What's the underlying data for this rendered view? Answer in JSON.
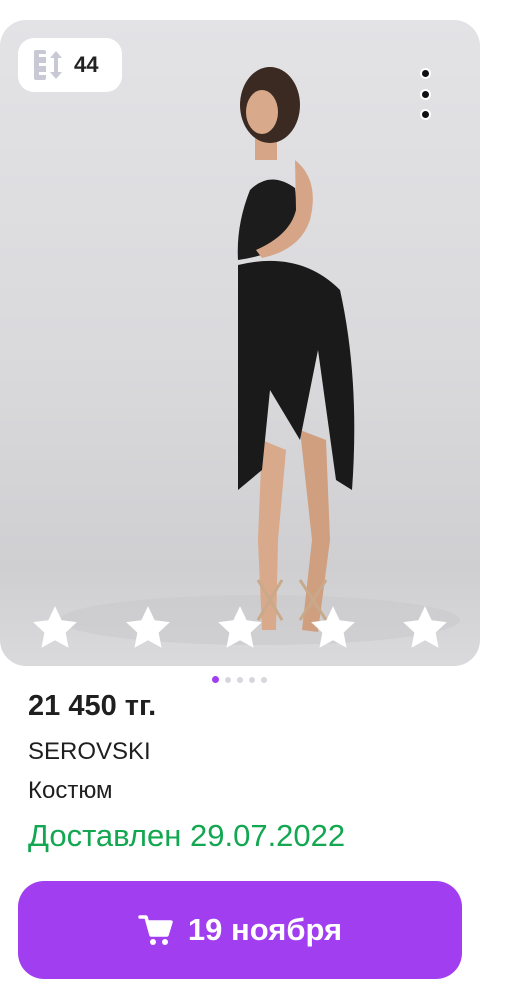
{
  "size_badge": {
    "value": "44",
    "icon": "height-ruler-icon"
  },
  "rating": {
    "stars_total": 5,
    "stars_filled": 5
  },
  "carousel": {
    "total": 5,
    "active_index": 1
  },
  "product": {
    "price": "21 450 тг.",
    "brand": "SEROVSKI",
    "type": "Костюм",
    "delivery_status": "Доставлен 29.07.2022"
  },
  "action_button": {
    "label": "19 ноября",
    "icon": "cart-icon"
  },
  "colors": {
    "accent": "#a13ff0",
    "delivered_green": "#13a751",
    "text": "#1f1f1f"
  }
}
